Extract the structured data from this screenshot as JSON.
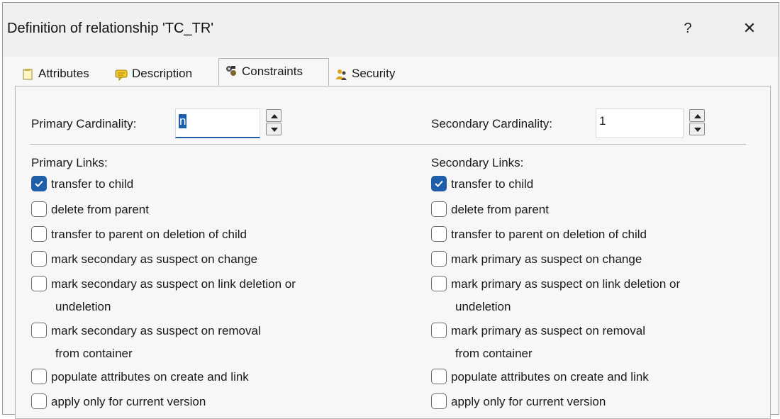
{
  "dialog": {
    "title": "Definition of relationship 'TC_TR'",
    "help_label": "?",
    "close_label": "✕"
  },
  "tabs": [
    {
      "label": "Attributes",
      "icon": "document-icon",
      "active": false
    },
    {
      "label": "Description",
      "icon": "note-icon",
      "active": false
    },
    {
      "label": "Constraints",
      "icon": "constraints-icon",
      "active": true
    },
    {
      "label": "Security",
      "icon": "users-icon",
      "active": false
    }
  ],
  "constraints": {
    "primary_cardinality": {
      "label": "Primary Cardinality:",
      "value": "n"
    },
    "secondary_cardinality": {
      "label": "Secondary Cardinality:",
      "value": "1"
    },
    "primary_links": {
      "heading": "Primary Links:",
      "options": [
        {
          "line1": "transfer to child",
          "line2": "",
          "checked": true
        },
        {
          "line1": "delete from parent",
          "line2": "",
          "checked": false
        },
        {
          "line1": "transfer to parent on deletion of child",
          "line2": "",
          "checked": false
        },
        {
          "line1": "mark secondary as suspect on change",
          "line2": "",
          "checked": false
        },
        {
          "line1": "mark secondary as suspect on link deletion or",
          "line2": "undeletion",
          "checked": false
        },
        {
          "line1": "mark secondary as suspect on removal",
          "line2": "from container",
          "checked": false
        },
        {
          "line1": "populate attributes on create and link",
          "line2": "",
          "checked": false
        },
        {
          "line1": "apply only for current version",
          "line2": "",
          "checked": false
        }
      ]
    },
    "secondary_links": {
      "heading": "Secondary Links:",
      "options": [
        {
          "line1": "transfer to child",
          "line2": "",
          "checked": true
        },
        {
          "line1": "delete from parent",
          "line2": "",
          "checked": false
        },
        {
          "line1": "transfer to parent on deletion of child",
          "line2": "",
          "checked": false
        },
        {
          "line1": "mark primary as suspect on change",
          "line2": "",
          "checked": false
        },
        {
          "line1": "mark primary as suspect on link deletion or",
          "line2": "undeletion",
          "checked": false
        },
        {
          "line1": "mark primary as suspect on removal",
          "line2": "from container",
          "checked": false
        },
        {
          "line1": "populate attributes on create and link",
          "line2": "",
          "checked": false
        },
        {
          "line1": "apply only for current version",
          "line2": "",
          "checked": false
        }
      ]
    }
  },
  "colors": {
    "accent": "#1f5ea8",
    "panel": "#f7f7f7",
    "titlebar": "#f0f0f0"
  }
}
